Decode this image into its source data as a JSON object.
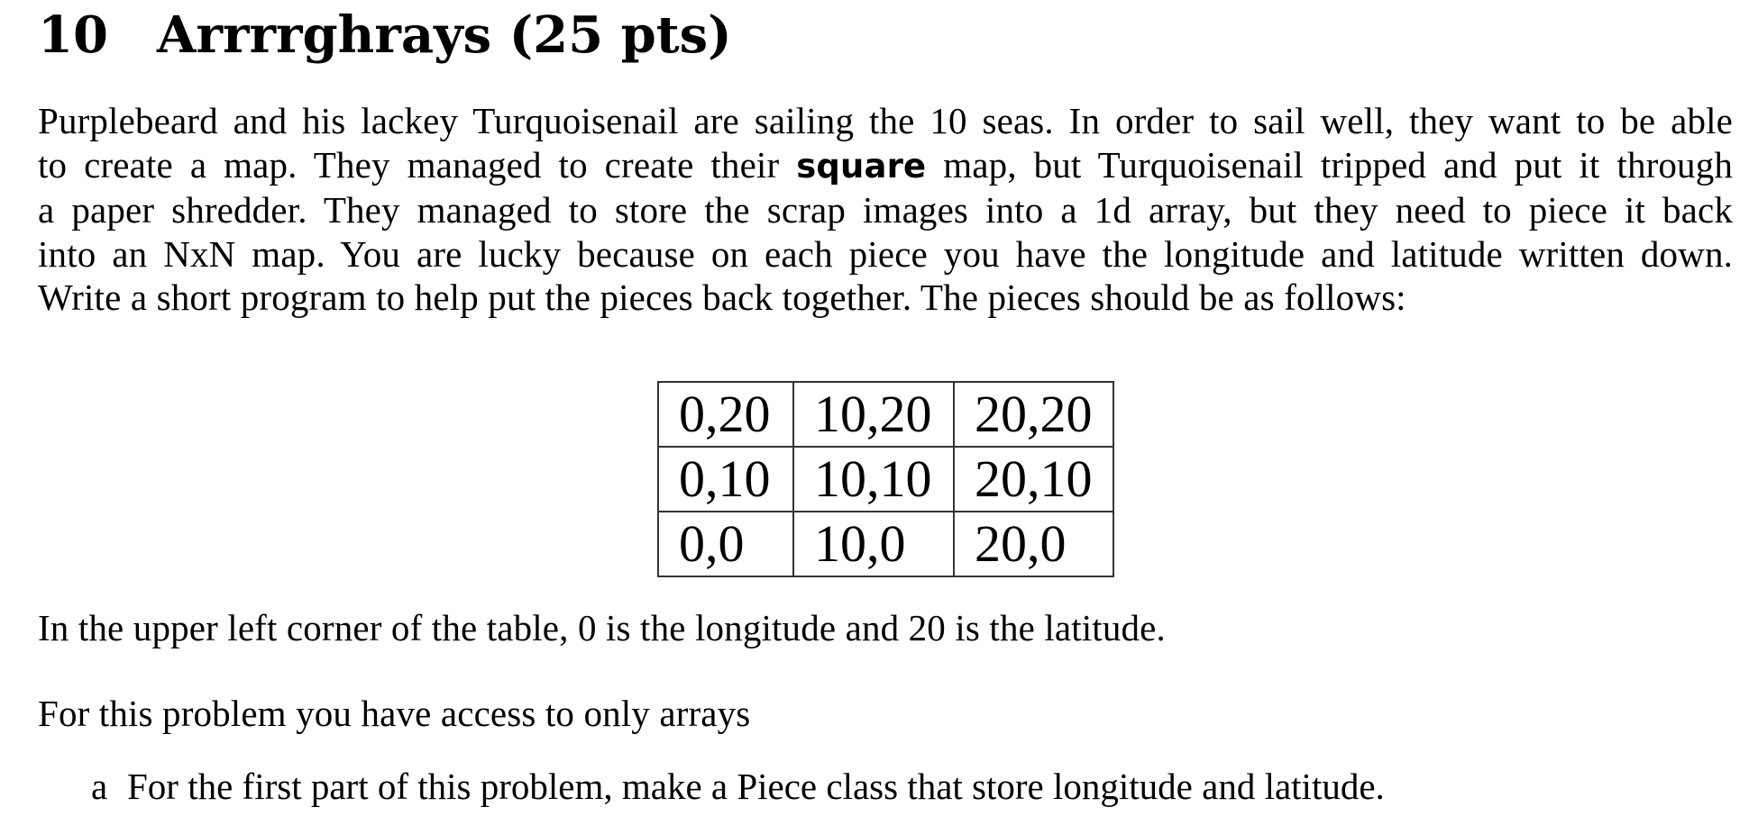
{
  "section": {
    "number": "10",
    "title": "Arrrrghrays (25 pts)"
  },
  "intro": {
    "line1": "Purplebeard and his lackey Turquoisenail are sailing the 10 seas. In order to sail well, they want to be able",
    "line2_before": "to create a map. They managed to create their ",
    "line2_bold": "square",
    "line2_after": " map, but Turquoisenail tripped and put it through",
    "line3": "a paper shredder. They managed to store the scrap images into a 1d array, but they need to piece it back",
    "line4": "into an NxN map. You are lucky because on each piece you have the longitude and latitude written down.",
    "line5": "Write a short program to help put the pieces back together. The pieces should be as follows:"
  },
  "pieces_table": {
    "rows": [
      [
        "0,20",
        "10,20",
        "20,20"
      ],
      [
        "0,10",
        "10,10",
        "20,10"
      ],
      [
        "0,0",
        "10,0",
        "20,0"
      ]
    ]
  },
  "corner_note": "In the upper left corner of the table, 0 is the longitude and 20 is the latitude.",
  "arrays_note": "For this problem you have access to only arrays",
  "parts": [
    {
      "marker": "a",
      "text": "For the first part of this problem, make a Piece class that store longitude and latitude."
    }
  ]
}
